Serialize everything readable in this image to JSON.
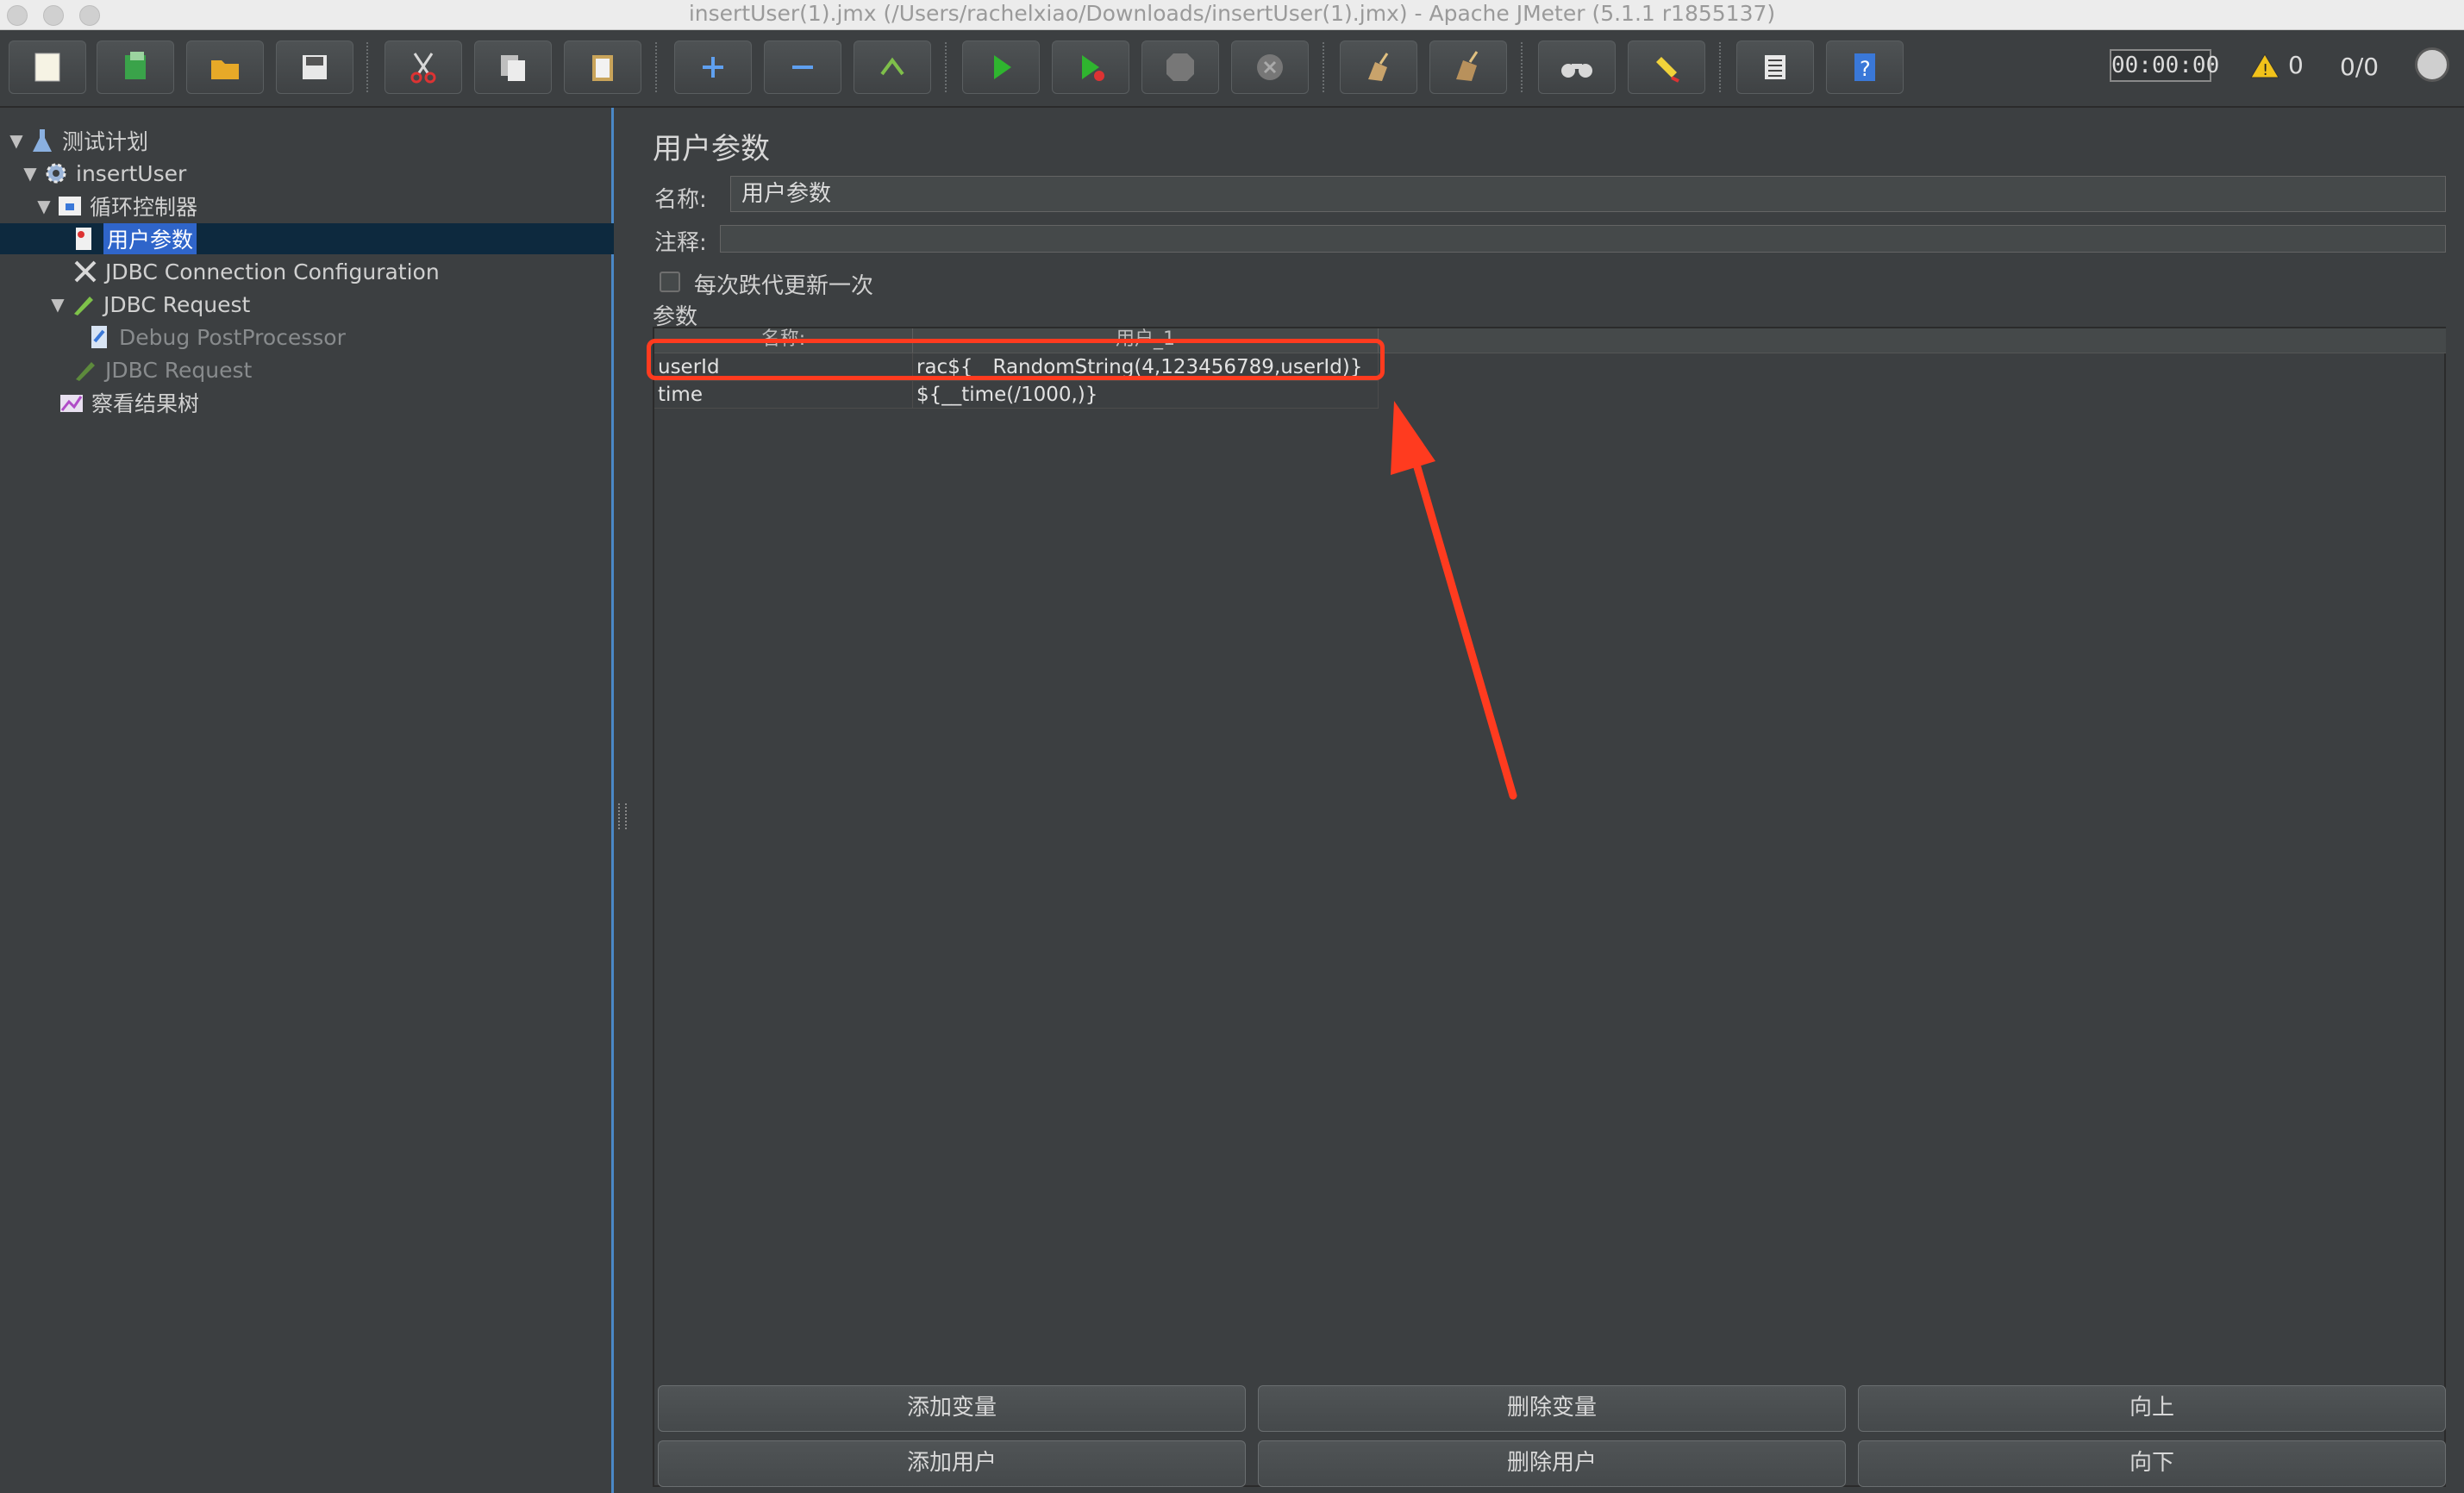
{
  "window": {
    "title": "insertUser(1).jmx (/Users/rachelxiao/Downloads/insertUser(1).jmx) - Apache JMeter (5.1.1 r1855137)"
  },
  "toolbar": {
    "buttons": [
      {
        "name": "new",
        "icon": "new-document-icon"
      },
      {
        "name": "templates",
        "icon": "templates-icon"
      },
      {
        "name": "open",
        "icon": "open-folder-icon"
      },
      {
        "name": "save",
        "icon": "save-icon"
      },
      {
        "name": "cut",
        "icon": "scissors-icon"
      },
      {
        "name": "copy",
        "icon": "copy-icon"
      },
      {
        "name": "paste",
        "icon": "paste-icon"
      },
      {
        "name": "expand",
        "icon": "plus-icon"
      },
      {
        "name": "collapse",
        "icon": "minus-icon"
      },
      {
        "name": "toggle",
        "icon": "toggle-icon"
      },
      {
        "name": "start",
        "icon": "play-icon"
      },
      {
        "name": "start-no-pauses",
        "icon": "play-no-pause-icon"
      },
      {
        "name": "stop",
        "icon": "stop-icon"
      },
      {
        "name": "shutdown",
        "icon": "shutdown-icon"
      },
      {
        "name": "clear",
        "icon": "broom-icon"
      },
      {
        "name": "clear-all",
        "icon": "broom-all-icon"
      },
      {
        "name": "search",
        "icon": "binoculars-icon"
      },
      {
        "name": "reset-search",
        "icon": "reset-search-icon"
      },
      {
        "name": "function-helper",
        "icon": "function-list-icon"
      },
      {
        "name": "help",
        "icon": "help-icon"
      }
    ],
    "timer": "00:00:00",
    "warnings": "0",
    "threads": "0/0"
  },
  "tree": {
    "items": [
      {
        "label": "测试计划",
        "icon": "test-plan-icon",
        "expanded": true
      },
      {
        "label": "insertUser",
        "icon": "gear-icon",
        "expanded": true
      },
      {
        "label": "循环控制器",
        "icon": "loop-controller-icon",
        "expanded": true
      },
      {
        "label": "用户参数",
        "icon": "user-parameters-icon",
        "selected": true
      },
      {
        "label": "JDBC Connection Configuration",
        "icon": "wrench-icon"
      },
      {
        "label": "JDBC Request",
        "icon": "pen-icon",
        "expanded": true
      },
      {
        "label": "Debug PostProcessor",
        "icon": "debug-icon",
        "disabled": true
      },
      {
        "label": "JDBC Request",
        "icon": "pen-icon",
        "disabled": true
      },
      {
        "label": "察看结果树",
        "icon": "chart-icon"
      }
    ]
  },
  "panel": {
    "title": "用户参数",
    "name_label": "名称:",
    "name_value": "用户参数",
    "comment_label": "注释:",
    "comment_value": "",
    "checkbox_label": "每次跌代更新一次",
    "checkbox_checked": false,
    "params_label": "参数",
    "table": {
      "columns": [
        "名称:",
        "用户_1"
      ],
      "rows": [
        [
          "userId",
          "rac${__RandomString(4,123456789,userId)}"
        ],
        [
          "time",
          "${__time(/1000,)}"
        ]
      ]
    },
    "buttons": {
      "add_variable": "添加变量",
      "delete_variable": "删除变量",
      "up": "向上",
      "add_user": "添加用户",
      "delete_user": "删除用户",
      "down": "向下"
    }
  },
  "annotation": {
    "highlight_color": "#ff3b1f"
  }
}
